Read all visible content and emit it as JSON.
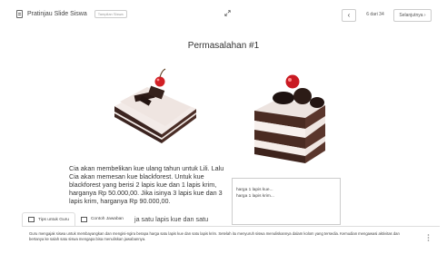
{
  "header": {
    "title": "Pratinjau Slide Siswa",
    "badge": "Tampilan Siswa",
    "prev_label": "‹",
    "page_info": "6 dari 34",
    "next_label": "Selanjutnya ›"
  },
  "slide": {
    "title": "Permasalahan #1",
    "story": "Cia akan membelikan kue ulang tahun untuk Lili. Lalu Cia akan memesan kue blackforest. Untuk kue blackforest yang berisi 2 lapis kue dan 1 lapis krim, harganya Rp 50.000,00. Jika isinya 3 lapis kue dan 3 lapis krim, harganya Rp 90.000,00.",
    "story_tail": "ja satu lapis kue dan satu",
    "answer_lines": [
      "harga 1 lapis kue...",
      "harga 1 lapis krim..."
    ]
  },
  "tabs": [
    {
      "label": "Tips untuk Guru",
      "icon": "book-icon"
    },
    {
      "label": "Contoh Jawaban",
      "icon": "document-icon"
    }
  ],
  "guide": {
    "text": "Guru mengajak siswa untuk membayangkan dan mengisi-ngira berapa harga satu lapis kue dan satu lapis krim. Setelah itu menyuruh siswa menuliskannya dalam kolom yang tersedia. Kemudian mengawasi aktivitas dan bertanya ke salah satu siswa mengapa bisa menuliskan jawabannya."
  }
}
